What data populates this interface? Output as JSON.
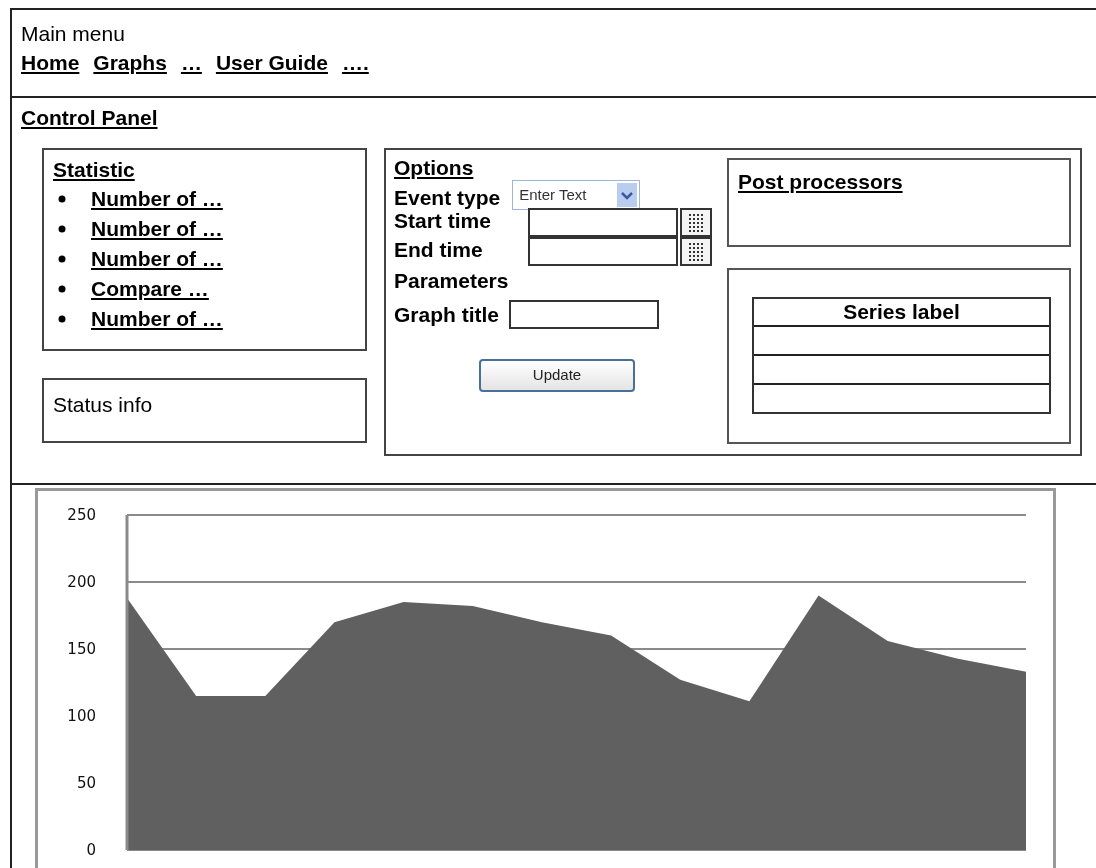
{
  "main_menu": {
    "title": "Main menu",
    "links": [
      "Home",
      "Graphs",
      "…",
      "User Guide",
      "…."
    ]
  },
  "control_panel": {
    "title": "Control Panel",
    "statistic": {
      "title": "Statistic",
      "items": [
        "Number of …",
        "Number of …",
        "Number of …",
        "Compare …",
        "Number of …"
      ]
    },
    "status": {
      "text": "Status info"
    },
    "options": {
      "title": "Options",
      "fields": [
        {
          "kind": "dropdown",
          "label": "Event type",
          "placeholder": "Enter Text"
        },
        {
          "kind": "date",
          "label": "Start time"
        },
        {
          "kind": "date",
          "label": "End time"
        },
        {
          "kind": "heading",
          "label": "Parameters"
        },
        {
          "kind": "text",
          "label": "Graph title"
        }
      ],
      "button": "Update"
    },
    "post_processors": {
      "title": "Post processors"
    },
    "series_table": {
      "columns": [
        "Series label"
      ],
      "rows": [
        {},
        {},
        {}
      ]
    }
  },
  "chart": {
    "chart_data": {
      "type": "area",
      "values": [
        188,
        115,
        115,
        170,
        185,
        182,
        170,
        160,
        127,
        111,
        190,
        156,
        143,
        133
      ],
      "ylim": [
        0,
        250
      ],
      "yticks": [
        0,
        50,
        100,
        150,
        200,
        250
      ]
    }
  }
}
